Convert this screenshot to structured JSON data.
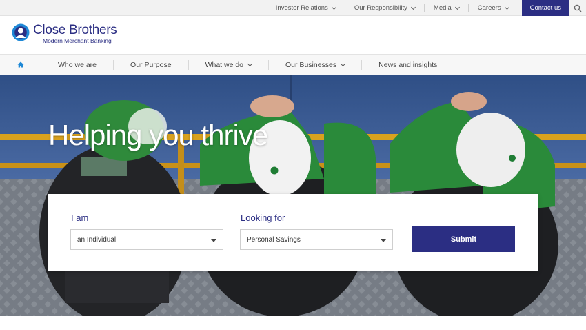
{
  "utility_nav": {
    "links": [
      {
        "label": "Investor Relations"
      },
      {
        "label": "Our Responsibility"
      },
      {
        "label": "Media"
      },
      {
        "label": "Careers"
      }
    ],
    "contact_label": "Contact us"
  },
  "logo": {
    "name": "Close Brothers",
    "tagline": "Modern Merchant Banking"
  },
  "main_nav": {
    "items": [
      {
        "label": "Who we are"
      },
      {
        "label": "Our Purpose"
      },
      {
        "label": "What we do"
      },
      {
        "label": "Our Businesses"
      },
      {
        "label": "News and insights"
      }
    ]
  },
  "hero": {
    "title": "Helping you thrive"
  },
  "form": {
    "i_am_label": "I am",
    "i_am_value": "an Individual",
    "looking_for_label": "Looking for",
    "looking_for_value": "Personal Savings",
    "submit_label": "Submit"
  },
  "colors": {
    "brand": "#2b2e83",
    "accent_blue": "#1e88d6"
  },
  "icons": [
    "search-icon",
    "home-icon",
    "chevron-down-icon",
    "logo-mark-icon"
  ]
}
